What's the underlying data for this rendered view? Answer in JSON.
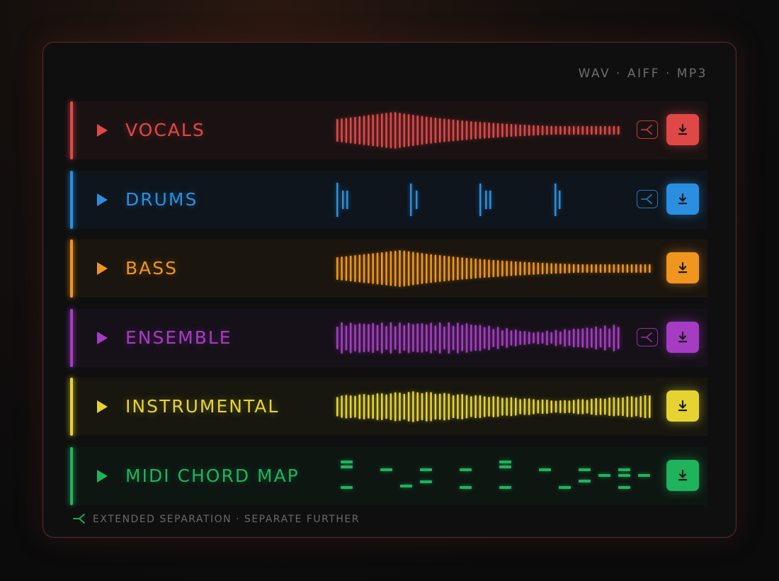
{
  "formats": "WAV · AIFF · MP3",
  "footer": {
    "text": "EXTENDED SEPARATION · SEPARATE FURTHER",
    "icon": "split-icon",
    "color": "#1fa85a"
  },
  "stems": [
    {
      "label": "VOCALS",
      "color": "#e04848",
      "bg": "#1a1212",
      "wave": "smooth-decay",
      "split": true,
      "icon": "download-icon"
    },
    {
      "label": "DRUMS",
      "color": "#2a8fe0",
      "bg": "#0f151c",
      "wave": "transients",
      "split": true,
      "icon": "download-icon"
    },
    {
      "label": "BASS",
      "color": "#f0951e",
      "bg": "#1a150e",
      "wave": "smooth-decay",
      "split": false,
      "icon": "download-icon"
    },
    {
      "label": "ENSEMBLE",
      "color": "#a63cc4",
      "bg": "#161118",
      "wave": "jagged",
      "split": true,
      "icon": "download-icon"
    },
    {
      "label": "INSTRUMENTAL",
      "color": "#e5d332",
      "bg": "#17170f",
      "wave": "swell",
      "split": false,
      "icon": "download-icon"
    },
    {
      "label": "MIDI CHORD MAP",
      "color": "#1fb35c",
      "bg": "#0e1612",
      "wave": "midi",
      "split": false,
      "icon": "download-icon"
    }
  ]
}
